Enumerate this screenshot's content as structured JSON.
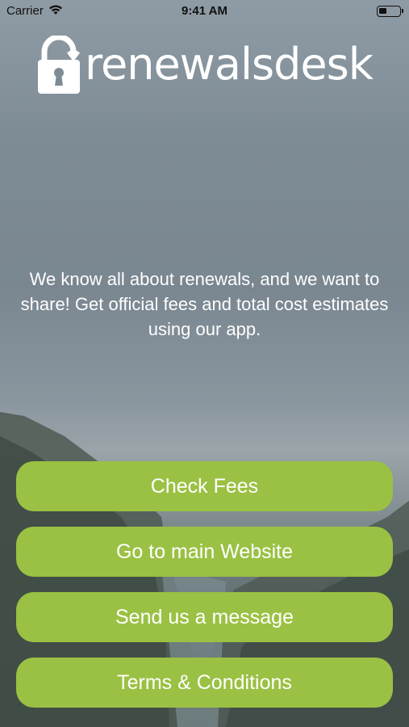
{
  "status_bar": {
    "carrier": "Carrier",
    "time": "9:41 AM",
    "wifi_icon": "wifi-icon",
    "battery_icon": "battery-icon"
  },
  "logo": {
    "text": "renewalsdesk",
    "icon": "padlock-icon"
  },
  "tagline": "We know all about renewals, and we want to share! Get official fees and total cost estimates using our app.",
  "buttons": {
    "check_fees": "Check Fees",
    "main_website": "Go to main Website",
    "send_message": "Send us a message",
    "terms": "Terms & Conditions"
  },
  "colors": {
    "button": "#9ac143",
    "text": "#ffffff"
  }
}
